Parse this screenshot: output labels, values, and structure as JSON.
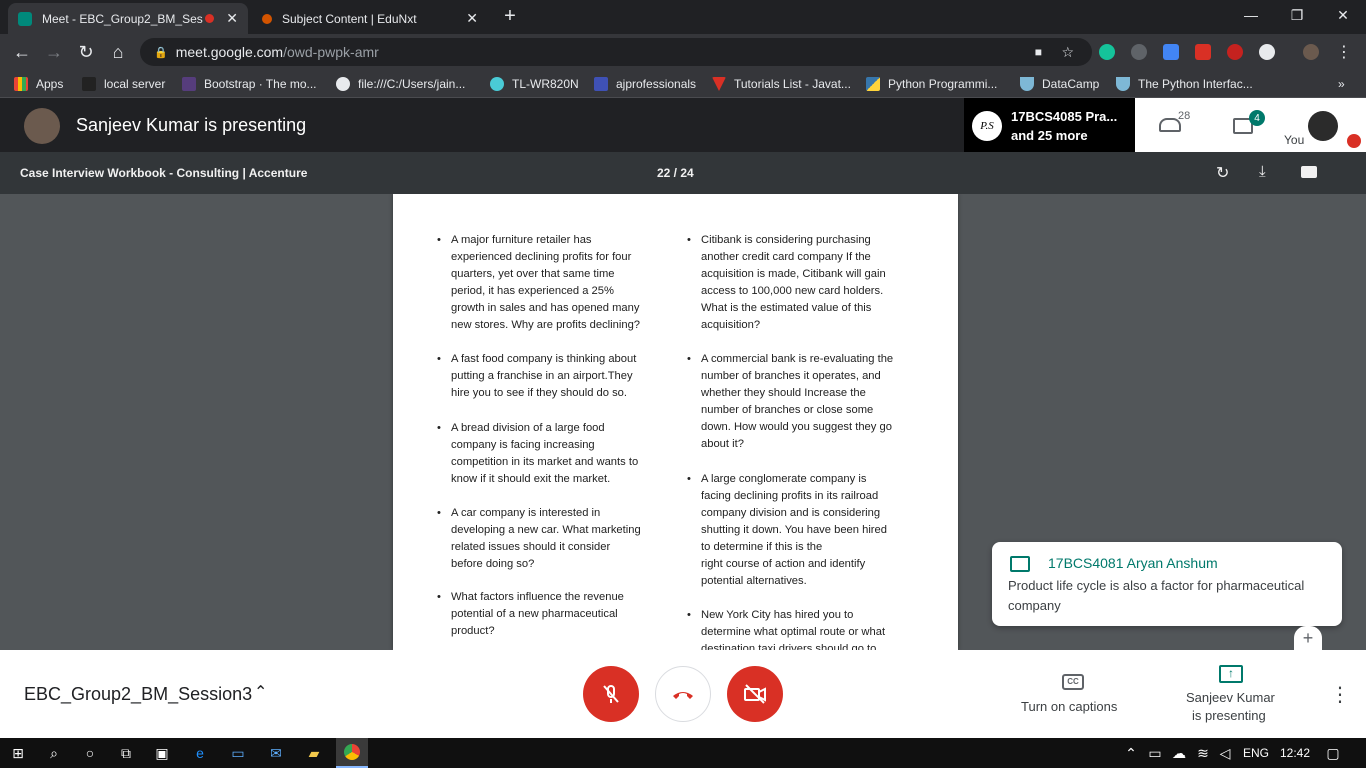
{
  "browser": {
    "tabs": [
      {
        "label": "Meet - EBC_Group2_BM_Ses"
      },
      {
        "label": "Subject Content | EduNxt"
      }
    ],
    "new_tab": "+",
    "url_host": "meet.google.com",
    "url_path": "/owd-pwpk-amr"
  },
  "bookmarks": [
    {
      "label": "Apps"
    },
    {
      "label": "local server"
    },
    {
      "label": "Bootstrap · The mo..."
    },
    {
      "label": "file:///C:/Users/jain..."
    },
    {
      "label": "TL-WR820N"
    },
    {
      "label": "ajprofessionals"
    },
    {
      "label": "Tutorials List - Javat..."
    },
    {
      "label": "Python Programmi..."
    },
    {
      "label": "DataCamp"
    },
    {
      "label": "The Python Interfac..."
    }
  ],
  "meet": {
    "presenting_title": "Sanjeev Kumar is presenting",
    "participant_initials": "P.S",
    "participant_line1": "17BCS4085 Pra...",
    "participant_line2": "and 25 more",
    "people_count": "28",
    "chat_count": "4",
    "you_label": "You"
  },
  "pdf": {
    "title": "Case Interview Workbook - Consulting | Accenture",
    "page_indicator": "22 / 24",
    "left_bullets": [
      {
        "lines": [
          "A major furniture retailer has",
          "experienced declining profits for four",
          "quarters, yet over that same time",
          "period, it has experienced a 25%",
          "growth in sales and has opened many",
          "new stores. Why are profits declining?"
        ]
      },
      {
        "lines": [
          "A fast food company is thinking about",
          "putting a franchise in an airport.They",
          "hire you to see if they should do so."
        ]
      },
      {
        "lines": [
          "A bread division of a large food",
          "company is facing increasing",
          "competition in its market and wants to",
          "know if it should exit the market."
        ]
      },
      {
        "lines": [
          "A car company is interested in",
          "developing a new car. What marketing",
          "related issues should it consider",
          "before doing so?"
        ]
      },
      {
        "lines": [
          "What factors influence the revenue",
          "potential of a new pharmaceutical",
          "product?"
        ]
      }
    ],
    "right_bullets": [
      {
        "lines": [
          "Citibank is considering purchasing",
          "another credit card company If the",
          "acquisition is made, Citibank will gain",
          "access to 100,000 new card holders.",
          "What is the estimated value of this",
          "acquisition?"
        ]
      },
      {
        "lines": [
          "A commercial bank is re-evaluating the",
          "number of branches it operates, and",
          "whether they should Increase the",
          "number of branches or close some",
          "down. How would you suggest they go",
          "about it?"
        ]
      },
      {
        "lines": [
          "A large conglomerate company is",
          "facing declining profits in its railroad",
          "company division and is considering",
          "shutting it down. You have been hired",
          "to determine if this is the",
          "right course of action and identify",
          "potential alternatives."
        ]
      },
      {
        "lines": [
          "New York City has hired you to",
          "determine what optimal route or what",
          "destination taxi drivers should go to"
        ]
      }
    ]
  },
  "chat_toast": {
    "sender": "17BCS4081 Aryan Anshum",
    "message_line1": "Product life cycle is also a factor for pharmaceutical",
    "message_line2": "company",
    "add_label": "+"
  },
  "bottom": {
    "meeting_name": "EBC_Group2_BM_Session3",
    "captions_label": "Turn on captions",
    "presenting_line1": "Sanjeev Kumar",
    "presenting_line2": "is presenting"
  },
  "taskbar": {
    "language": "ENG",
    "time": "12:42"
  },
  "colors": {
    "meet_red": "#d93025",
    "teal": "#00796b",
    "chrome_dark": "#202124"
  }
}
